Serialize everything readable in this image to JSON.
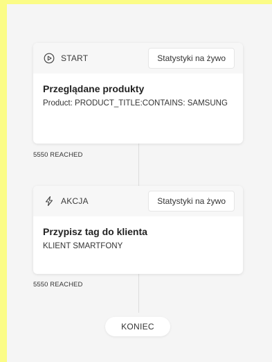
{
  "flow": {
    "start_card": {
      "header_label": "START",
      "header_icon": "play-circle-icon",
      "stats_button_label": "Statystyki na żywo",
      "title": "Przeglądane produkty",
      "detail": "Product: PRODUCT_TITLE:CONTAINS: SAMSUNG"
    },
    "start_reached": "5550 REACHED",
    "action_card": {
      "header_label": "AKCJA",
      "header_icon": "lightning-icon",
      "stats_button_label": "Statystyki na żywo",
      "title": "Przypisz tag do klienta",
      "detail": "KLIENT SMARTFONY"
    },
    "action_reached": "5550 REACHED",
    "end_label": "KONIEC"
  },
  "colors": {
    "outer_background": "#fbfc86",
    "canvas_background": "#f5f5f5",
    "card_background": "#ffffff",
    "card_header_background": "#f7f7f7",
    "connector": "#dcdcdc"
  }
}
